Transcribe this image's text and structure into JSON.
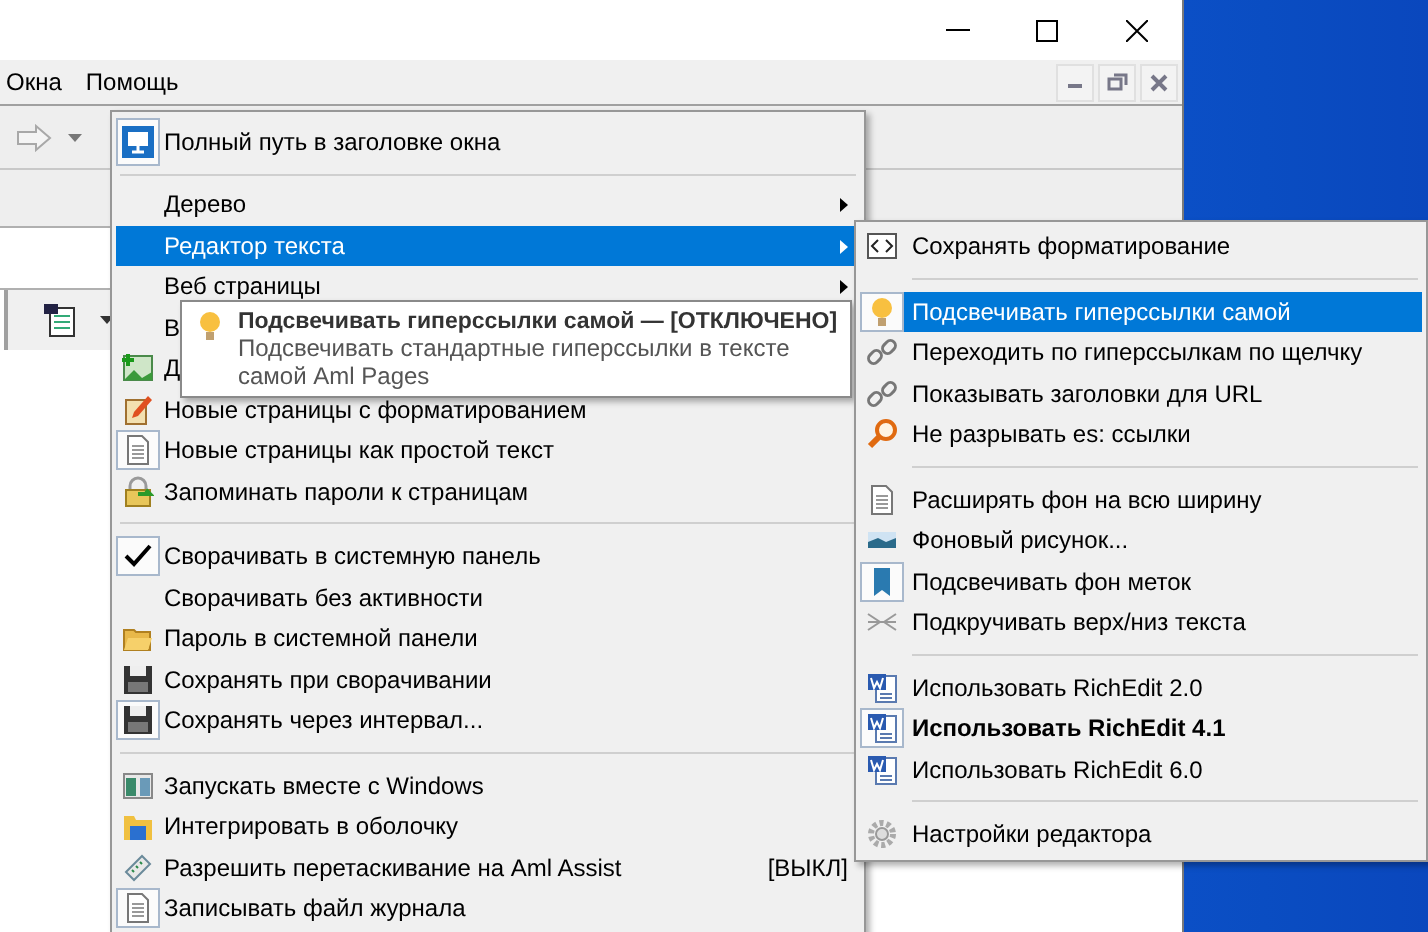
{
  "menu_bar": {
    "items": [
      {
        "label": "Окна"
      },
      {
        "label": "Помощь"
      }
    ]
  },
  "context_menu": {
    "items": [
      {
        "kind": "item",
        "label": "Полный путь в заголовке окна",
        "checked": true,
        "selected": false,
        "submenu": false
      },
      {
        "kind": "separator"
      },
      {
        "kind": "item",
        "label": "Дерево",
        "checked": false,
        "selected": false,
        "submenu": true
      },
      {
        "kind": "item",
        "label": "Редактор текста",
        "checked": false,
        "selected": true,
        "submenu": true
      },
      {
        "kind": "item",
        "label": "Веб страницы",
        "checked": false,
        "selected": false,
        "submenu": true
      },
      {
        "kind": "item",
        "label": "В",
        "checked": false,
        "selected": false,
        "submenu": false
      },
      {
        "kind": "item",
        "label": "Д",
        "checked": false,
        "selected": false,
        "submenu": false
      },
      {
        "kind": "item",
        "label": "Новые страницы с форматированием",
        "checked": false,
        "selected": false,
        "submenu": false
      },
      {
        "kind": "item",
        "label": "Новые страницы как простой текст",
        "checked": true,
        "selected": false,
        "submenu": false
      },
      {
        "kind": "item",
        "label": "Запоминать пароли к страницам",
        "checked": false,
        "selected": false,
        "submenu": false
      },
      {
        "kind": "separator"
      },
      {
        "kind": "item",
        "label": "Сворачивать в системную панель",
        "checked": true,
        "selected": false,
        "submenu": false
      },
      {
        "kind": "item",
        "label": "Сворачивать без активности",
        "checked": false,
        "selected": false,
        "submenu": false
      },
      {
        "kind": "item",
        "label": "Пароль в системной панели",
        "checked": false,
        "selected": false,
        "submenu": false
      },
      {
        "kind": "item",
        "label": "Сохранять при сворачивании",
        "checked": false,
        "selected": false,
        "submenu": false
      },
      {
        "kind": "item",
        "label": "Сохранять через интервал...",
        "checked": true,
        "selected": false,
        "submenu": false
      },
      {
        "kind": "separator"
      },
      {
        "kind": "item",
        "label": "Запускать вместе с Windows",
        "checked": false,
        "selected": false,
        "submenu": false
      },
      {
        "kind": "item",
        "label": "Интегрировать в оболочку",
        "checked": false,
        "selected": false,
        "submenu": false
      },
      {
        "kind": "item",
        "label": "Разрешить перетаскивание на Aml Assist",
        "shortcut": "[ВЫКЛ]",
        "checked": false,
        "selected": false,
        "submenu": false
      },
      {
        "kind": "item",
        "label": "Записывать файл журнала",
        "checked": true,
        "selected": false,
        "submenu": false
      }
    ]
  },
  "submenu": {
    "items": [
      {
        "kind": "item",
        "label": "Сохранять форматирование",
        "checked": false,
        "selected": false,
        "default": false
      },
      {
        "kind": "separator"
      },
      {
        "kind": "item",
        "label": "Подсвечивать гиперссылки самой",
        "checked": true,
        "selected": true,
        "default": false
      },
      {
        "kind": "item",
        "label": "Переходить по гиперссылкам по щелчку",
        "checked": false,
        "selected": false,
        "default": false
      },
      {
        "kind": "item",
        "label": "Показывать заголовки для URL",
        "checked": false,
        "selected": false,
        "default": false
      },
      {
        "kind": "item",
        "label": "Не разрывать es: ссылки",
        "checked": false,
        "selected": false,
        "default": false
      },
      {
        "kind": "separator"
      },
      {
        "kind": "item",
        "label": "Расширять фон на всю ширину",
        "checked": false,
        "selected": false,
        "default": false
      },
      {
        "kind": "item",
        "label": "Фоновый рисунок...",
        "checked": false,
        "selected": false,
        "default": false
      },
      {
        "kind": "item",
        "label": "Подсвечивать фон меток",
        "checked": true,
        "selected": false,
        "default": false
      },
      {
        "kind": "item",
        "label": "Подкручивать верх/низ текста",
        "checked": false,
        "selected": false,
        "default": false
      },
      {
        "kind": "separator"
      },
      {
        "kind": "item",
        "label": "Использовать RichEdit 2.0",
        "checked": false,
        "selected": false,
        "default": false
      },
      {
        "kind": "item",
        "label": "Использовать RichEdit 4.1",
        "checked": true,
        "selected": false,
        "default": true
      },
      {
        "kind": "item",
        "label": "Использовать RichEdit 6.0",
        "checked": false,
        "selected": false,
        "default": false
      },
      {
        "kind": "separator"
      },
      {
        "kind": "item",
        "label": "Настройки редактора",
        "checked": false,
        "selected": false,
        "default": false
      }
    ]
  },
  "tooltip": {
    "title": "Подсвечивать гиперссылки самой — [ОТКЛЮЧЕНО]",
    "text": "Подсвечивать стандартные гиперссылки в тексте самой Aml Pages"
  }
}
